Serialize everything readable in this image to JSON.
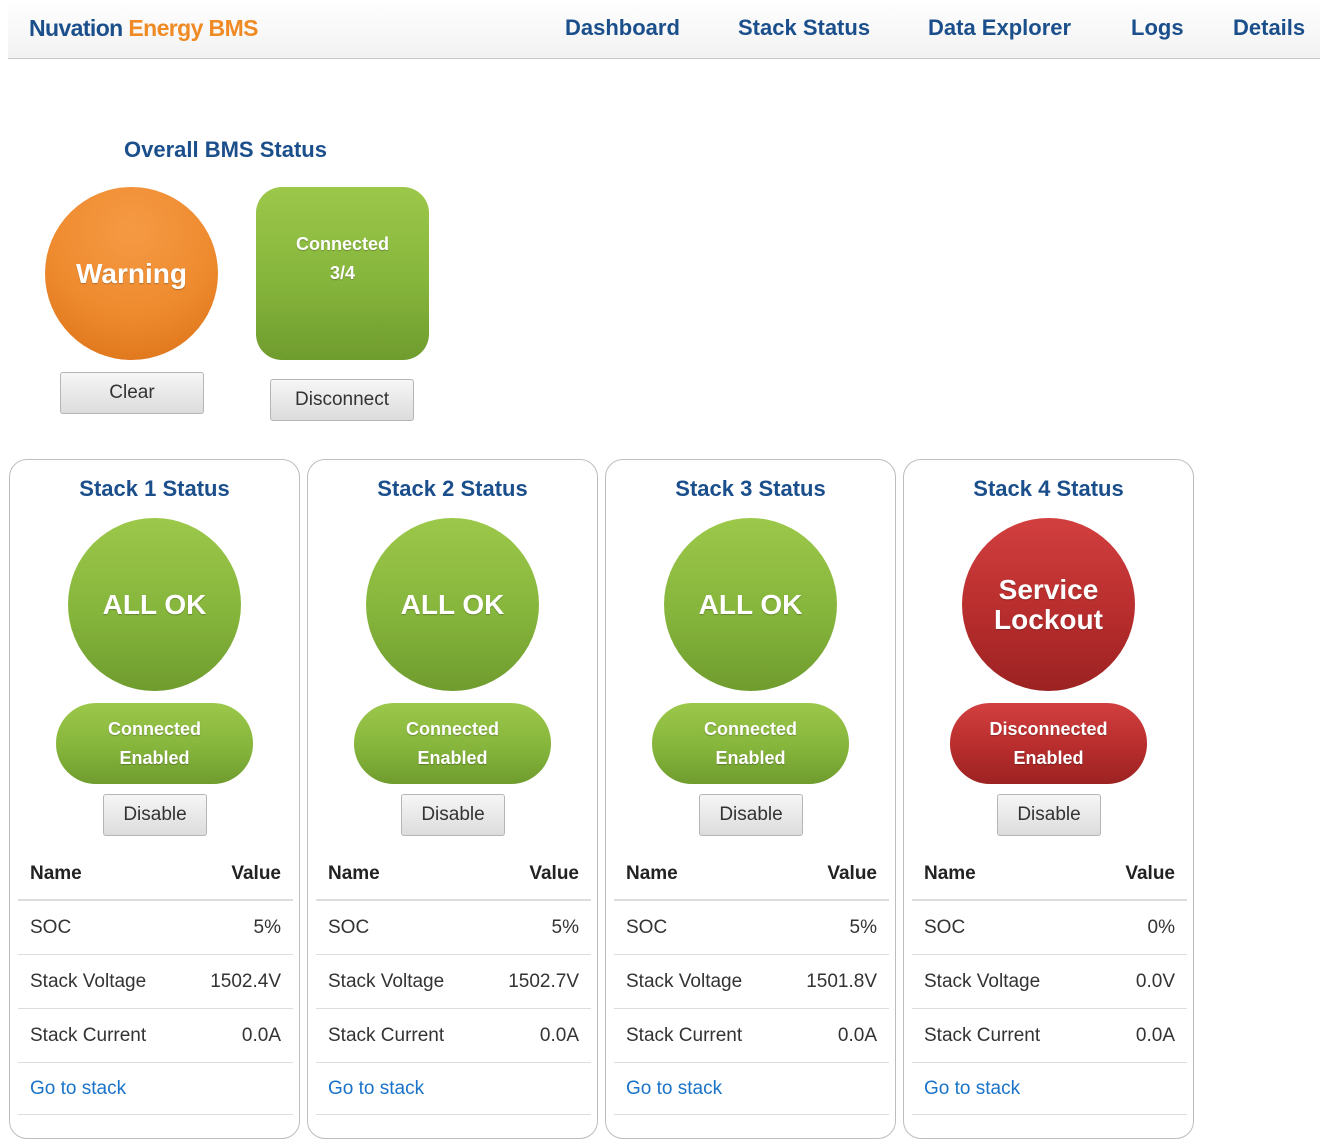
{
  "header": {
    "brand_part1": "Nuvation",
    "brand_part2": "Energy BMS",
    "nav": [
      "Dashboard",
      "Stack Status",
      "Data Explorer",
      "Logs",
      "Details"
    ]
  },
  "overall": {
    "title": "Overall BMS Status",
    "status": "Warning",
    "status_color": "#ee8a2e",
    "clear_label": "Clear",
    "connection_line1": "Connected",
    "connection_line2": "3/4",
    "disconnect_label": "Disconnect"
  },
  "table_headers": {
    "name": "Name",
    "value": "Value"
  },
  "stacks": [
    {
      "title": "Stack 1 Status",
      "status_line1": "ALL OK",
      "status_line2": "",
      "status_color": "#86b53c",
      "conn_line1": "Connected",
      "conn_line2": "Enabled",
      "button_label": "Disable",
      "rows": [
        {
          "name": "SOC",
          "value": "5%"
        },
        {
          "name": "Stack Voltage",
          "value": "1502.4V"
        },
        {
          "name": "Stack Current",
          "value": "0.0A"
        }
      ],
      "link_label": "Go to stack"
    },
    {
      "title": "Stack 2 Status",
      "status_line1": "ALL OK",
      "status_line2": "",
      "status_color": "#86b53c",
      "conn_line1": "Connected",
      "conn_line2": "Enabled",
      "button_label": "Disable",
      "rows": [
        {
          "name": "SOC",
          "value": "5%"
        },
        {
          "name": "Stack Voltage",
          "value": "1502.7V"
        },
        {
          "name": "Stack Current",
          "value": "0.0A"
        }
      ],
      "link_label": "Go to stack"
    },
    {
      "title": "Stack 3 Status",
      "status_line1": "ALL OK",
      "status_line2": "",
      "status_color": "#86b53c",
      "conn_line1": "Connected",
      "conn_line2": "Enabled",
      "button_label": "Disable",
      "rows": [
        {
          "name": "SOC",
          "value": "5%"
        },
        {
          "name": "Stack Voltage",
          "value": "1501.8V"
        },
        {
          "name": "Stack Current",
          "value": "0.0A"
        }
      ],
      "link_label": "Go to stack"
    },
    {
      "title": "Stack 4 Status",
      "status_line1": "Service",
      "status_line2": "Lockout",
      "status_color": "#b82d2d",
      "conn_line1": "Disconnected",
      "conn_line2": "Enabled",
      "button_label": "Disable",
      "rows": [
        {
          "name": "SOC",
          "value": "0%"
        },
        {
          "name": "Stack Voltage",
          "value": "0.0V"
        },
        {
          "name": "Stack Current",
          "value": "0.0A"
        }
      ],
      "link_label": "Go to stack"
    }
  ]
}
